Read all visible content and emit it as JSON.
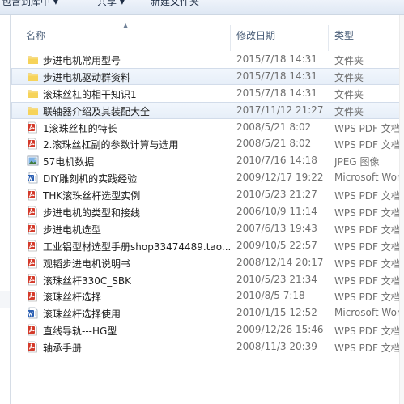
{
  "toolbar": {
    "organize": "包含到库中 ▾",
    "share": "共享 ▾",
    "new_folder": "新建文件夹"
  },
  "columns": {
    "name": "名称",
    "modified": "修改日期",
    "type": "类型"
  },
  "rows": [
    {
      "name": "步进电机常用型号",
      "date": "2015/7/18 14:31",
      "type": "文件夹",
      "icon": "folder-icon",
      "selected": false
    },
    {
      "name": "步进电机驱动群资料",
      "date": "2015/7/18 14:31",
      "type": "文件夹",
      "icon": "folder-icon",
      "selected": true
    },
    {
      "name": "滚珠丝杠的相干知识1",
      "date": "2015/7/18 14:31",
      "type": "文件夹",
      "icon": "folder-icon",
      "selected": false
    },
    {
      "name": "联轴器介绍及其装配大全",
      "date": "2017/11/12 21:27",
      "type": "文件夹",
      "icon": "folder-icon",
      "selected": true
    },
    {
      "name": "1滚珠丝杠的特长",
      "date": "2008/5/21 8:02",
      "type": "WPS PDF 文档",
      "icon": "pdf-icon",
      "selected": false
    },
    {
      "name": "2.滚珠丝杠副的参数计算与选用",
      "date": "2008/5/21 8:02",
      "type": "WPS PDF 文档",
      "icon": "pdf-icon",
      "selected": false
    },
    {
      "name": "57电机数据",
      "date": "2010/7/16 14:18",
      "type": "JPEG 图像",
      "icon": "image-icon",
      "selected": false
    },
    {
      "name": "DIY雕刻机的实践经验",
      "date": "2009/12/17 19:22",
      "type": "Microsoft Wor",
      "icon": "word-icon",
      "selected": false
    },
    {
      "name": "THK滚珠丝杆选型实例",
      "date": "2010/5/23 21:27",
      "type": "WPS PDF 文档",
      "icon": "pdf-icon",
      "selected": false
    },
    {
      "name": "步进电机的类型和接线",
      "date": "2006/10/9 11:14",
      "type": "WPS PDF 文档",
      "icon": "pdf-icon",
      "selected": false
    },
    {
      "name": "步进电机选型",
      "date": "2007/6/13 19:43",
      "type": "WPS PDF 文档",
      "icon": "pdf-icon",
      "selected": false
    },
    {
      "name": "工业铝型材选型手册shop33474489.tao...",
      "date": "2009/10/5 22:57",
      "type": "WPS PDF 文档",
      "icon": "pdf-icon",
      "selected": false
    },
    {
      "name": "观韬步进电机说明书",
      "date": "2008/12/14 20:17",
      "type": "WPS PDF 文档",
      "icon": "pdf-icon",
      "selected": false
    },
    {
      "name": "滚珠丝杆330C_SBK",
      "date": "2010/5/23 21:34",
      "type": "WPS PDF 文档",
      "icon": "pdf-icon",
      "selected": false
    },
    {
      "name": "滚珠丝杆选择",
      "date": "2010/8/5 7:18",
      "type": "WPS PDF 文档",
      "icon": "pdf-icon",
      "selected": false
    },
    {
      "name": "滚珠丝杆选择使用",
      "date": "2010/1/15 12:52",
      "type": "Microsoft Wor",
      "icon": "word-icon",
      "selected": false
    },
    {
      "name": "直线导轨---HG型",
      "date": "2009/12/26 15:46",
      "type": "WPS PDF 文档",
      "icon": "pdf-icon",
      "selected": false
    },
    {
      "name": "轴承手册",
      "date": "2008/11/3 20:39",
      "type": "WPS PDF 文档",
      "icon": "pdf-icon",
      "selected": false
    }
  ]
}
